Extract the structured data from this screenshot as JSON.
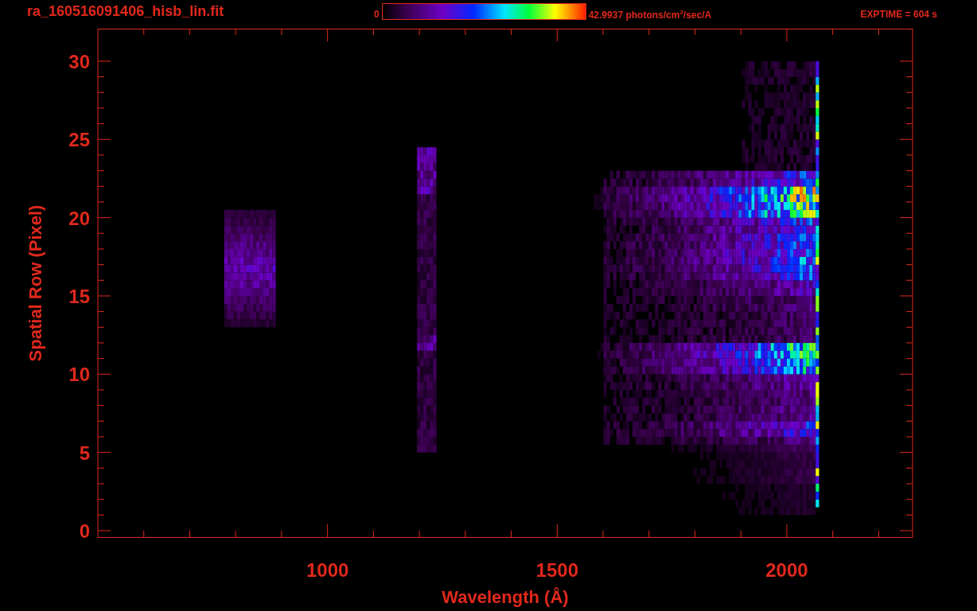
{
  "header": {
    "filename": "ra_160516091406_hisb_lin.fit",
    "colorbar": {
      "min_label": "0",
      "max_label": "42.9937 photons/cm$^{2}$/sec/A"
    },
    "exptime": "EXPTIME = 604 s"
  },
  "plot": {
    "xlabel": "Wavelength (Å)",
    "ylabel": "Spatial Row (Pixel)",
    "xtick_labels": [
      "1000",
      "1500",
      "2000"
    ],
    "ytick_labels": [
      "30",
      "25",
      "20",
      "15",
      "10",
      "5",
      "0"
    ]
  }
}
